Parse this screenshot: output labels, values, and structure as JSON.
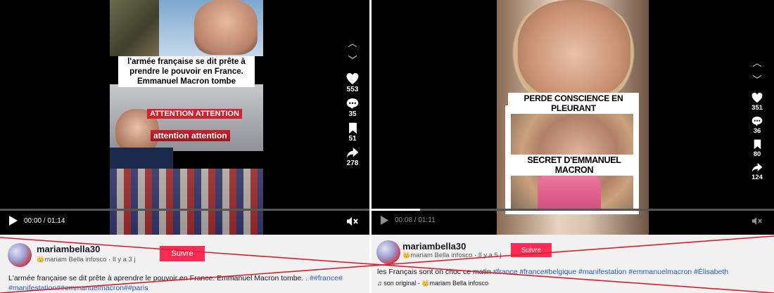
{
  "posts": [
    {
      "video": {
        "caption": "l'armée française se dit prête à prendre le pouvoir en France. Emmanuel Macron tombe",
        "banner1": "ATTENTION ATTENTION",
        "banner2": "attention attention"
      },
      "actions": {
        "likes": "553",
        "comments": "35",
        "saves": "51",
        "shares": "278"
      },
      "controls": {
        "time": "00:00 / 01:14",
        "progress": 0.0
      },
      "author": {
        "username": "mariambella30",
        "display": "mariam Bella infosco",
        "age": "Il y a 3 j"
      },
      "follow_label": "Suivre",
      "description": "L'armée française se dit prête à aprendre le pouvoir en France. Emmanuel Macron tombe. . ",
      "hashtags": [
        "##france#",
        "#manifestation##emmanuelmacron##paris"
      ]
    },
    {
      "video": {
        "caption1": "PERDE CONSCIENCE EN PLEURANT",
        "caption2": "SECRET D'EMMANUEL MACRON"
      },
      "actions": {
        "likes": "351",
        "comments": "36",
        "saves": "80",
        "shares": "124"
      },
      "controls": {
        "time": "00:08 / 01:11",
        "progress": 0.12
      },
      "author": {
        "username": "mariambella30",
        "display": "mariam Bella infosco",
        "age": "Il y a 5 j"
      },
      "follow_label": "Suivre",
      "description": "les Français sont on choc ce matin ",
      "hashtags": [
        "#france",
        "#france",
        "#belgique",
        "#manifestation",
        "#emmanuelmacron",
        "#Élisabeth"
      ],
      "sound": {
        "label": "son original - ",
        "author": "mariam Bella infosco"
      }
    }
  ],
  "colors": {
    "follow": "#fe2c55",
    "hashtag": "#2b5db9",
    "cross": "#d6202f"
  },
  "icons": [
    "chevron-up-icon",
    "chevron-down-icon",
    "heart-icon",
    "comment-icon",
    "bookmark-icon",
    "share-icon",
    "play-icon",
    "mute-icon",
    "music-note-icon",
    "crown-icon"
  ]
}
